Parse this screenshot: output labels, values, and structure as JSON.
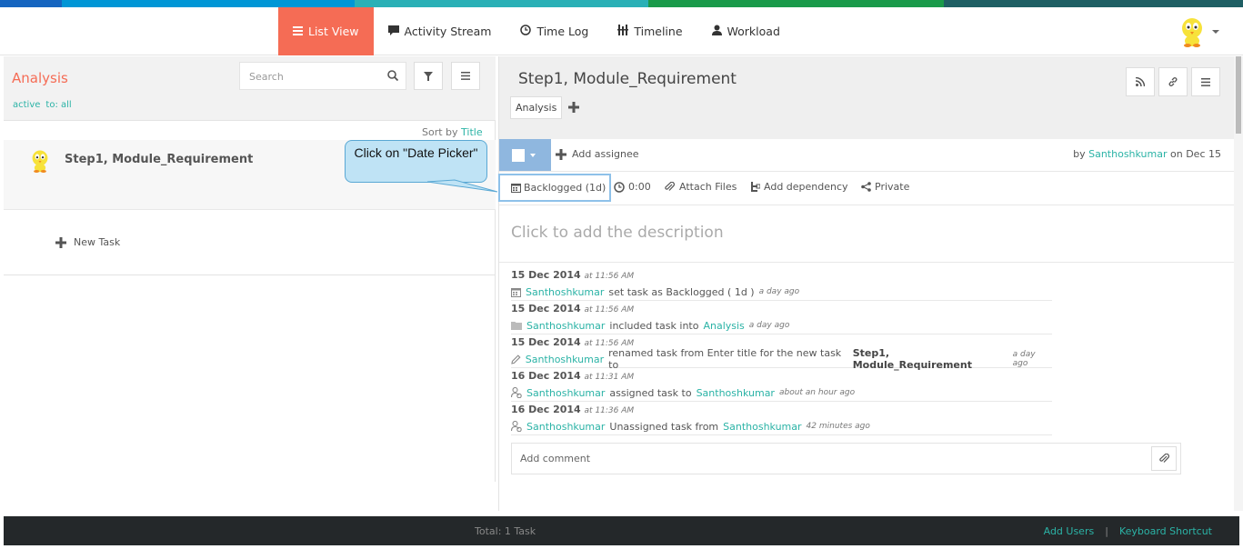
{
  "colors": {
    "accent": "#f56c55",
    "link": "#2bb3a6",
    "stripe": [
      "#1565c0",
      "#0096d6",
      "#2ab0b6",
      "#1a9a4a",
      "#1f5f64"
    ]
  },
  "nav": {
    "items": [
      {
        "label": "List View",
        "icon": "list-icon",
        "active": true
      },
      {
        "label": "Activity Stream",
        "icon": "comment-icon"
      },
      {
        "label": "Time Log",
        "icon": "clock-icon"
      },
      {
        "label": "Timeline",
        "icon": "timeline-icon"
      },
      {
        "label": "Workload",
        "icon": "user-icon"
      }
    ]
  },
  "left": {
    "title": "Analysis",
    "filters": [
      "active",
      "to: all"
    ],
    "search_placeholder": "Search",
    "sort_prefix": "Sort by",
    "sort_field": "Title",
    "task_title": "Step1, Module_Requirement",
    "new_task": "New Task"
  },
  "callout": {
    "text": "Click on \"Date Picker\""
  },
  "detail": {
    "title": "Step1, Module_Requirement",
    "tag": "Analysis",
    "add_assignee": "Add assignee",
    "by": "by",
    "author": "Santhoshkumar",
    "on": "on Dec 15",
    "date_picker": "Backlogged (1d)",
    "time": "0:00",
    "attach": "Attach Files",
    "dependency": "Add dependency",
    "private": "Private",
    "description_placeholder": "Click to add the description",
    "comment_placeholder": "Add comment"
  },
  "activity": [
    {
      "date": "15 Dec 2014",
      "time": "at 11:56 AM",
      "icon": "calendar-icon",
      "user": "Santhoshkumar",
      "text": "set task as Backlogged ( 1d )",
      "ago": "a day ago"
    },
    {
      "date": "15 Dec 2014",
      "time": "at 11:56 AM",
      "icon": "folder-icon",
      "user": "Santhoshkumar",
      "text": "included task into",
      "target": "Analysis",
      "ago": "a day ago"
    },
    {
      "date": "15 Dec 2014",
      "time": "at 11:56 AM",
      "icon": "pencil-icon",
      "user": "Santhoshkumar",
      "text": "renamed task from Enter title for the new task to",
      "bold": "Step1, Module_Requirement",
      "ago": "a day ago"
    },
    {
      "date": "16 Dec 2014",
      "time": "at 11:31 AM",
      "icon": "assign-user-icon",
      "user": "Santhoshkumar",
      "text": "assigned task to",
      "target": "Santhoshkumar",
      "ago": "about an hour ago"
    },
    {
      "date": "16 Dec 2014",
      "time": "at 11:36 AM",
      "icon": "assign-user-icon",
      "user": "Santhoshkumar",
      "text": "Unassigned task from",
      "target": "Santhoshkumar",
      "ago": "42 minutes ago"
    }
  ],
  "footer": {
    "total": "Total: 1 Task",
    "add_users": "Add Users",
    "separator": "|",
    "shortcut": "Keyboard Shortcut"
  }
}
